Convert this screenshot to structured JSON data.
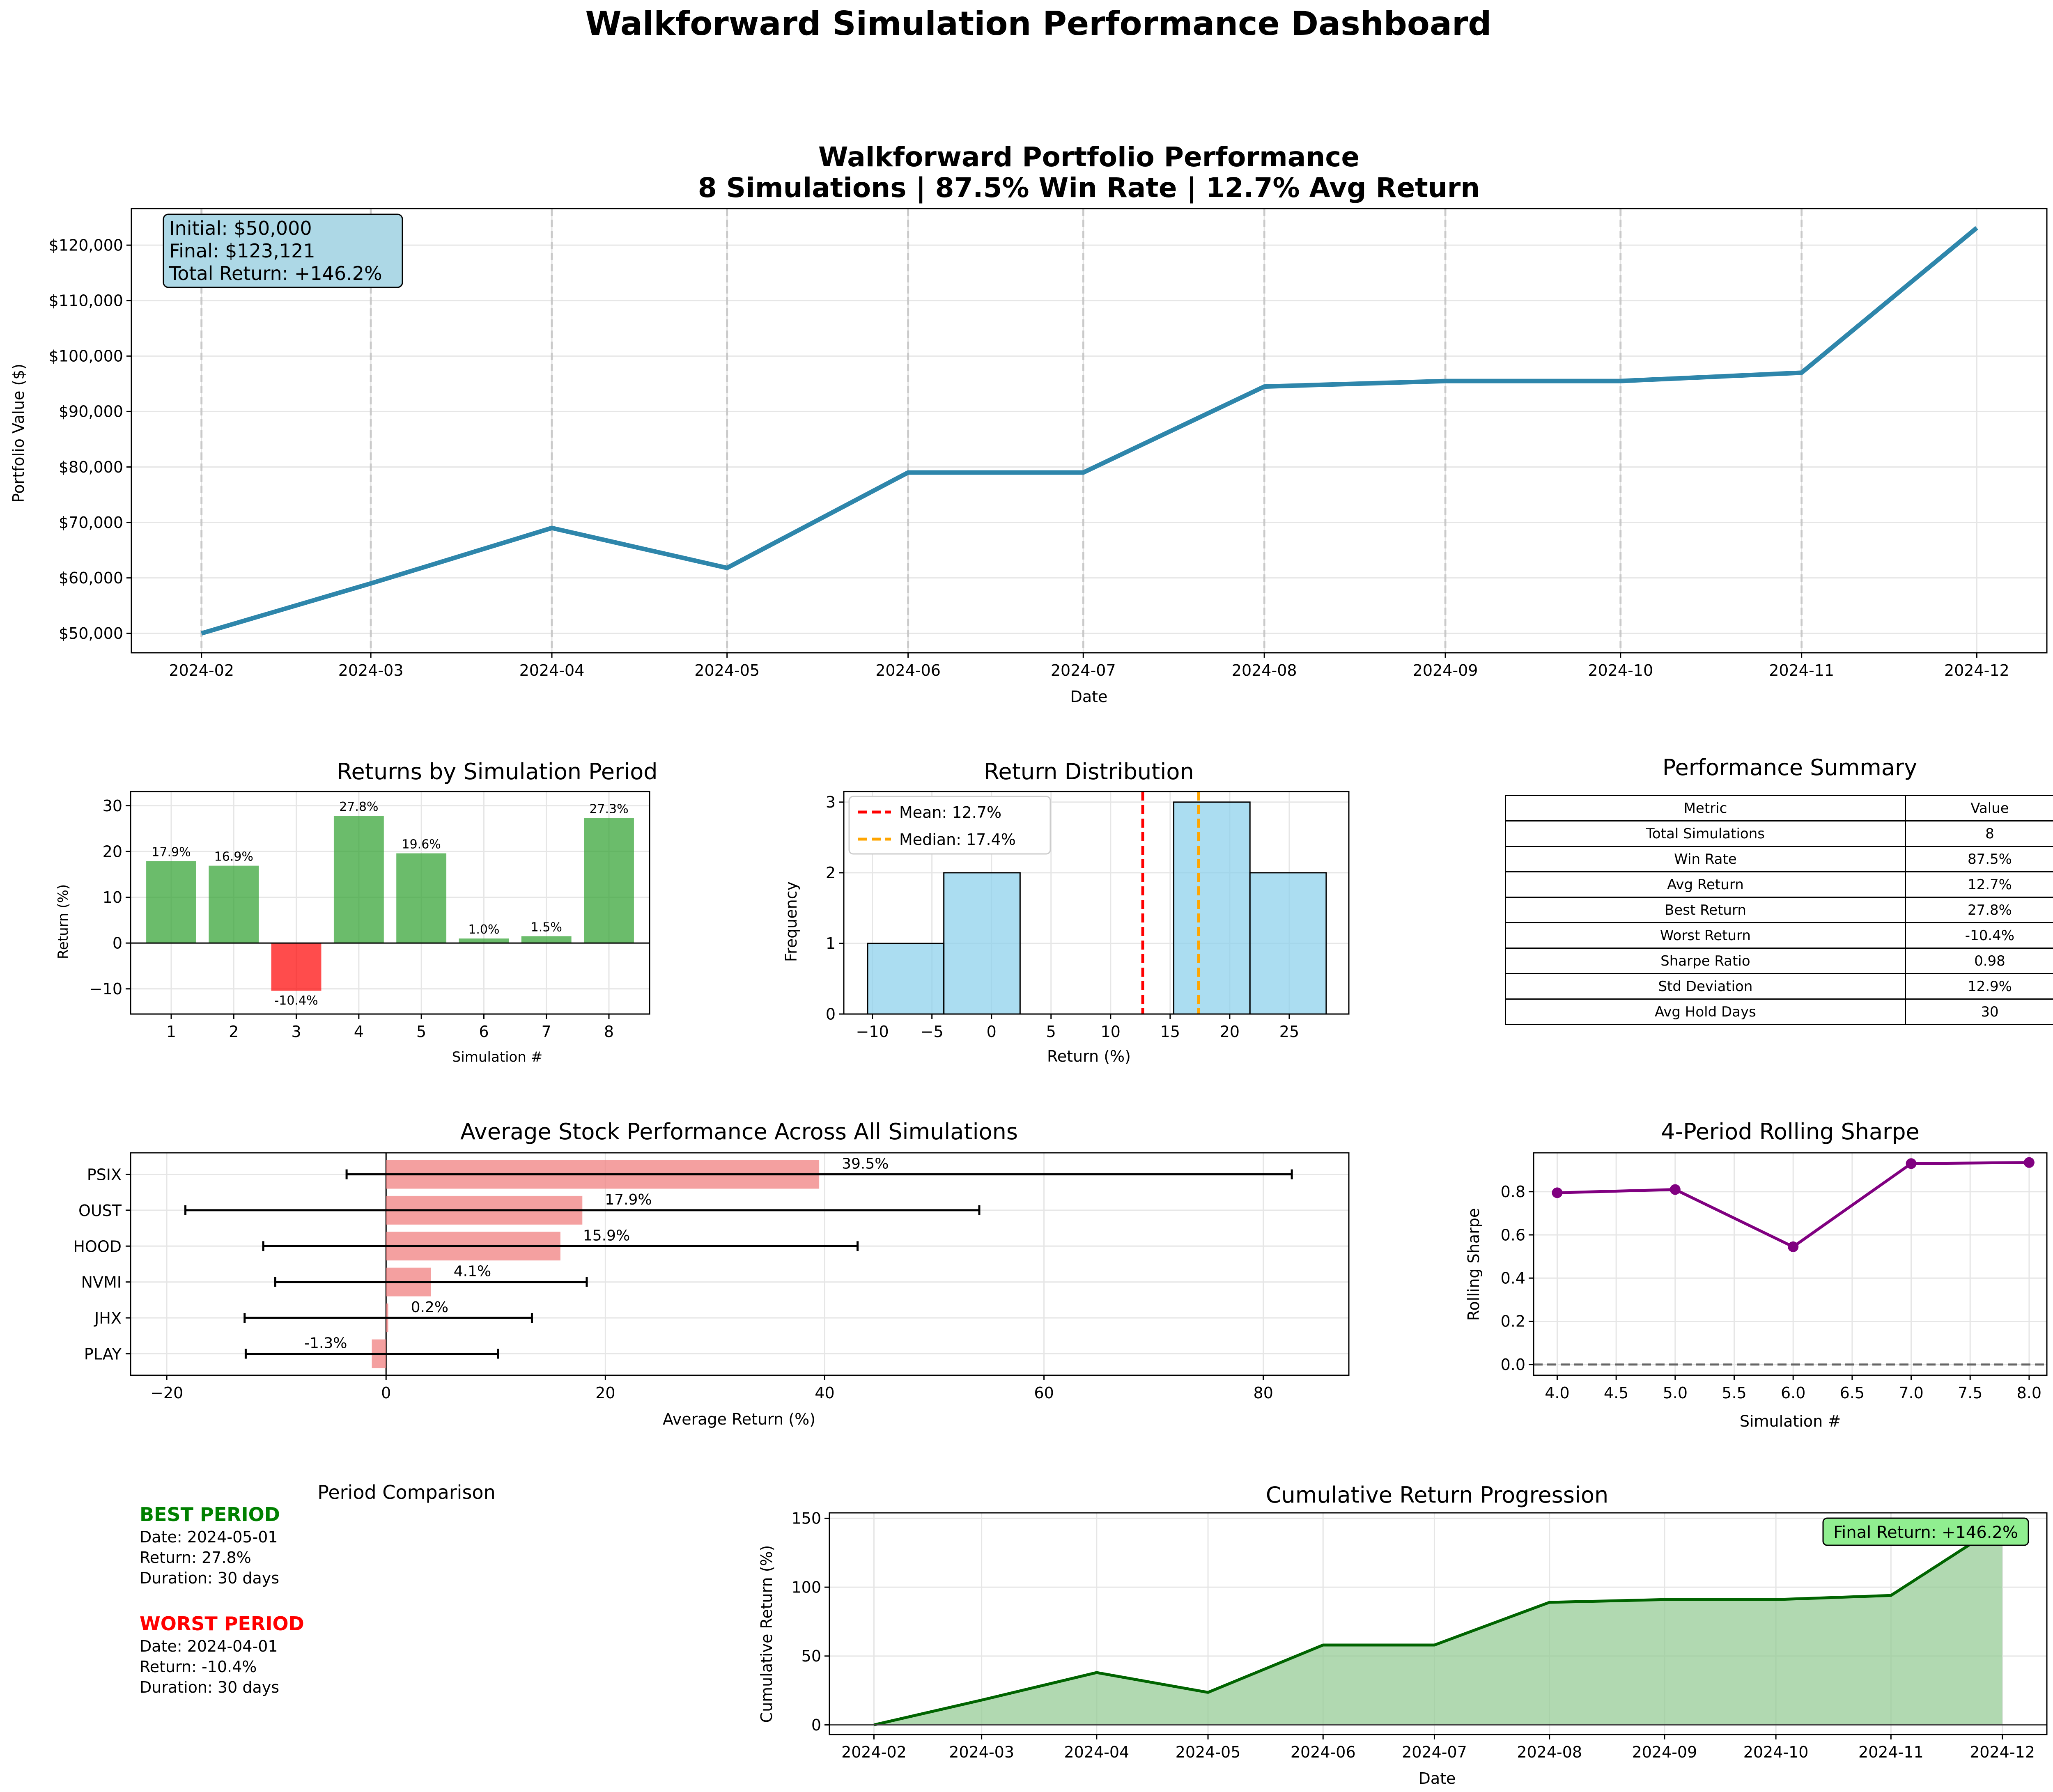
{
  "figure_title": "Walkforward Simulation Performance Dashboard",
  "colors": {
    "portfolio_line": "#2e86ab",
    "positive_bar": "#2ca02c",
    "negative_bar": "#ff0000",
    "hist_fill": "#87ceeb",
    "mean_line": "#ff0000",
    "median_line": "#ffa500",
    "stock_bar": "#f08080",
    "sharpe_line": "#800080",
    "cumulative_line": "#006400",
    "cumulative_fill": "#90c990",
    "info_box": "#add8e6",
    "final_box": "#90ee90",
    "best_text": "#008000",
    "worst_text": "#ff0000"
  },
  "chart_data": [
    {
      "id": "portfolio",
      "type": "line",
      "title": "Walkforward Portfolio Performance\n8 Simulations | 87.5% Win Rate | 12.7% Avg Return",
      "title_lines": [
        "Walkforward Portfolio Performance",
        "8 Simulations | 87.5% Win Rate | 12.7% Avg Return"
      ],
      "xlabel": "Date",
      "ylabel": "Portfolio Value ($)",
      "x": [
        "2024-02-01",
        "2024-03-01",
        "2024-04-01",
        "2024-05-01",
        "2024-06-01",
        "2024-07-01",
        "2024-08-01",
        "2024-09-01",
        "2024-10-01",
        "2024-11-01",
        "2024-12-01"
      ],
      "y": [
        50000,
        59000,
        69000,
        61800,
        79000,
        79000,
        94500,
        95500,
        95500,
        97000,
        123121
      ],
      "x_ticks": [
        "2024-02",
        "2024-03",
        "2024-04",
        "2024-05",
        "2024-06",
        "2024-07",
        "2024-08",
        "2024-09",
        "2024-10",
        "2024-11",
        "2024-12"
      ],
      "y_ticks": [
        "$50,000",
        "$60,000",
        "$70,000",
        "$80,000",
        "$90,000",
        "$100,000",
        "$110,000",
        "$120,000"
      ],
      "y_tick_values": [
        50000,
        60000,
        70000,
        80000,
        90000,
        100000,
        110000,
        120000
      ],
      "ylim": [
        46500,
        126600
      ],
      "vertical_markers": [
        "2024-02-01",
        "2024-03-01",
        "2024-04-01",
        "2024-05-01",
        "2024-06-01",
        "2024-07-01",
        "2024-08-01",
        "2024-09-01",
        "2024-10-01",
        "2024-11-01"
      ],
      "grid": true,
      "annotation": [
        "Initial: $50,000",
        "Final: $123,121",
        "Total Return: +146.2%"
      ]
    },
    {
      "id": "returns",
      "type": "bar",
      "title": "Returns by Simulation Period",
      "xlabel": "Simulation #",
      "ylabel": "Return (%)",
      "categories": [
        "1",
        "2",
        "3",
        "4",
        "5",
        "6",
        "7",
        "8"
      ],
      "values": [
        17.9,
        16.9,
        -10.4,
        27.8,
        19.6,
        1.0,
        1.5,
        27.3
      ],
      "labels": [
        "17.9%",
        "16.9%",
        "-10.4%",
        "27.8%",
        "19.6%",
        "1.0%",
        "1.5%",
        "27.3%"
      ],
      "y_ticks": [
        "−10",
        "0",
        "10",
        "20",
        "30"
      ],
      "y_tick_values": [
        -10,
        0,
        10,
        20,
        30
      ],
      "ylim": [
        -15.5,
        33.1
      ],
      "grid": true
    },
    {
      "id": "distribution",
      "type": "bar",
      "subtype": "histogram",
      "title": "Return Distribution",
      "xlabel": "Return (%)",
      "ylabel": "Frequency",
      "bins": [
        [
          -10.4,
          -4.0
        ],
        [
          -4.0,
          2.4
        ],
        [
          2.4,
          8.9
        ],
        [
          8.9,
          15.3
        ],
        [
          15.3,
          21.7
        ],
        [
          21.7,
          28.1
        ]
      ],
      "counts": [
        1,
        2,
        0,
        0,
        3,
        2
      ],
      "mean": 12.7,
      "median": 17.4,
      "legend": [
        "Mean: 12.7%",
        "Median: 17.4%"
      ],
      "legend_position": "top-left",
      "x_ticks": [
        "−10",
        "−5",
        "0",
        "5",
        "10",
        "15",
        "20",
        "25"
      ],
      "x_tick_values": [
        -10,
        -5,
        0,
        5,
        10,
        15,
        20,
        25
      ],
      "xlim": [
        -12.4,
        30.0
      ],
      "y_ticks": [
        "0",
        "1",
        "2",
        "3"
      ],
      "y_tick_values": [
        0,
        1,
        2,
        3
      ],
      "ylim": [
        0,
        3.15
      ],
      "grid": true
    },
    {
      "id": "summary",
      "type": "table",
      "title": "Performance Summary",
      "columns": [
        "Metric",
        "Value"
      ],
      "rows": [
        [
          "Total Simulations",
          "8"
        ],
        [
          "Win Rate",
          "87.5%"
        ],
        [
          "Avg Return",
          "12.7%"
        ],
        [
          "Best Return",
          "27.8%"
        ],
        [
          "Worst Return",
          "-10.4%"
        ],
        [
          "Sharpe Ratio",
          "0.98"
        ],
        [
          "Std Deviation",
          "12.9%"
        ],
        [
          "Avg Hold Days",
          "30"
        ]
      ]
    },
    {
      "id": "stocks",
      "type": "bar",
      "orientation": "horizontal",
      "title": "Average Stock Performance Across All Simulations",
      "xlabel": "Average Return (%)",
      "categories": [
        "PSIX",
        "OUST",
        "HOOD",
        "NVMI",
        "JHX",
        "PLAY"
      ],
      "values": [
        39.5,
        17.9,
        15.9,
        4.1,
        0.2,
        -1.3
      ],
      "labels": [
        "39.5%",
        "17.9%",
        "15.9%",
        "4.1%",
        "0.2%",
        "-1.3%"
      ],
      "error_low": [
        -3.6,
        -18.3,
        -11.2,
        -10.1,
        -12.9,
        -12.8
      ],
      "error_high": [
        82.6,
        54.1,
        43.0,
        18.3,
        13.3,
        10.2
      ],
      "x_ticks": [
        "−20",
        "0",
        "20",
        "40",
        "60",
        "80"
      ],
      "x_tick_values": [
        -20,
        0,
        20,
        40,
        60,
        80
      ],
      "xlim": [
        -23.3,
        87.8
      ],
      "grid": true
    },
    {
      "id": "sharpe",
      "type": "line",
      "title": "4-Period Rolling Sharpe",
      "xlabel": "Simulation #",
      "ylabel": "Rolling Sharpe",
      "x": [
        4,
        5,
        6,
        7,
        8
      ],
      "y": [
        0.795,
        0.81,
        0.545,
        0.93,
        0.935
      ],
      "x_ticks": [
        "4.0",
        "4.5",
        "5.0",
        "5.5",
        "6.0",
        "6.5",
        "7.0",
        "7.5",
        "8.0"
      ],
      "x_tick_values": [
        4.0,
        4.5,
        5.0,
        5.5,
        6.0,
        6.5,
        7.0,
        7.5,
        8.0
      ],
      "xlim": [
        3.8,
        8.15
      ],
      "y_ticks": [
        "0.0",
        "0.2",
        "0.4",
        "0.6",
        "0.8"
      ],
      "y_tick_values": [
        0.0,
        0.2,
        0.4,
        0.6,
        0.8
      ],
      "ylim": [
        -0.05,
        0.98
      ],
      "reference_line": 0,
      "grid": true
    },
    {
      "id": "cumulative",
      "type": "area",
      "title": "Cumulative Return Progression",
      "xlabel": "Date",
      "ylabel": "Cumulative Return (%)",
      "x": [
        "2024-02-01",
        "2024-03-01",
        "2024-04-01",
        "2024-05-01",
        "2024-06-01",
        "2024-07-01",
        "2024-08-01",
        "2024-09-01",
        "2024-10-01",
        "2024-11-01",
        "2024-12-01"
      ],
      "y": [
        0,
        18,
        38,
        23.6,
        58,
        58,
        89,
        91,
        91,
        94,
        146.2
      ],
      "x_ticks": [
        "2024-02",
        "2024-03",
        "2024-04",
        "2024-05",
        "2024-06",
        "2024-07",
        "2024-08",
        "2024-09",
        "2024-10",
        "2024-11",
        "2024-12"
      ],
      "y_ticks": [
        "0",
        "50",
        "100",
        "150"
      ],
      "y_tick_values": [
        0,
        50,
        100,
        150
      ],
      "ylim": [
        -7,
        154
      ],
      "reference_line": 0,
      "grid": true,
      "annotation": "Final Return: +146.2%"
    }
  ],
  "period_comparison": {
    "title": "Period Comparison",
    "best": {
      "heading": "BEST PERIOD",
      "date": "Date: 2024-05-01",
      "return": "Return: 27.8%",
      "duration": "Duration: 30 days"
    },
    "worst": {
      "heading": "WORST PERIOD",
      "date": "Date: 2024-04-01",
      "return": "Return: -10.4%",
      "duration": "Duration: 30 days"
    }
  }
}
